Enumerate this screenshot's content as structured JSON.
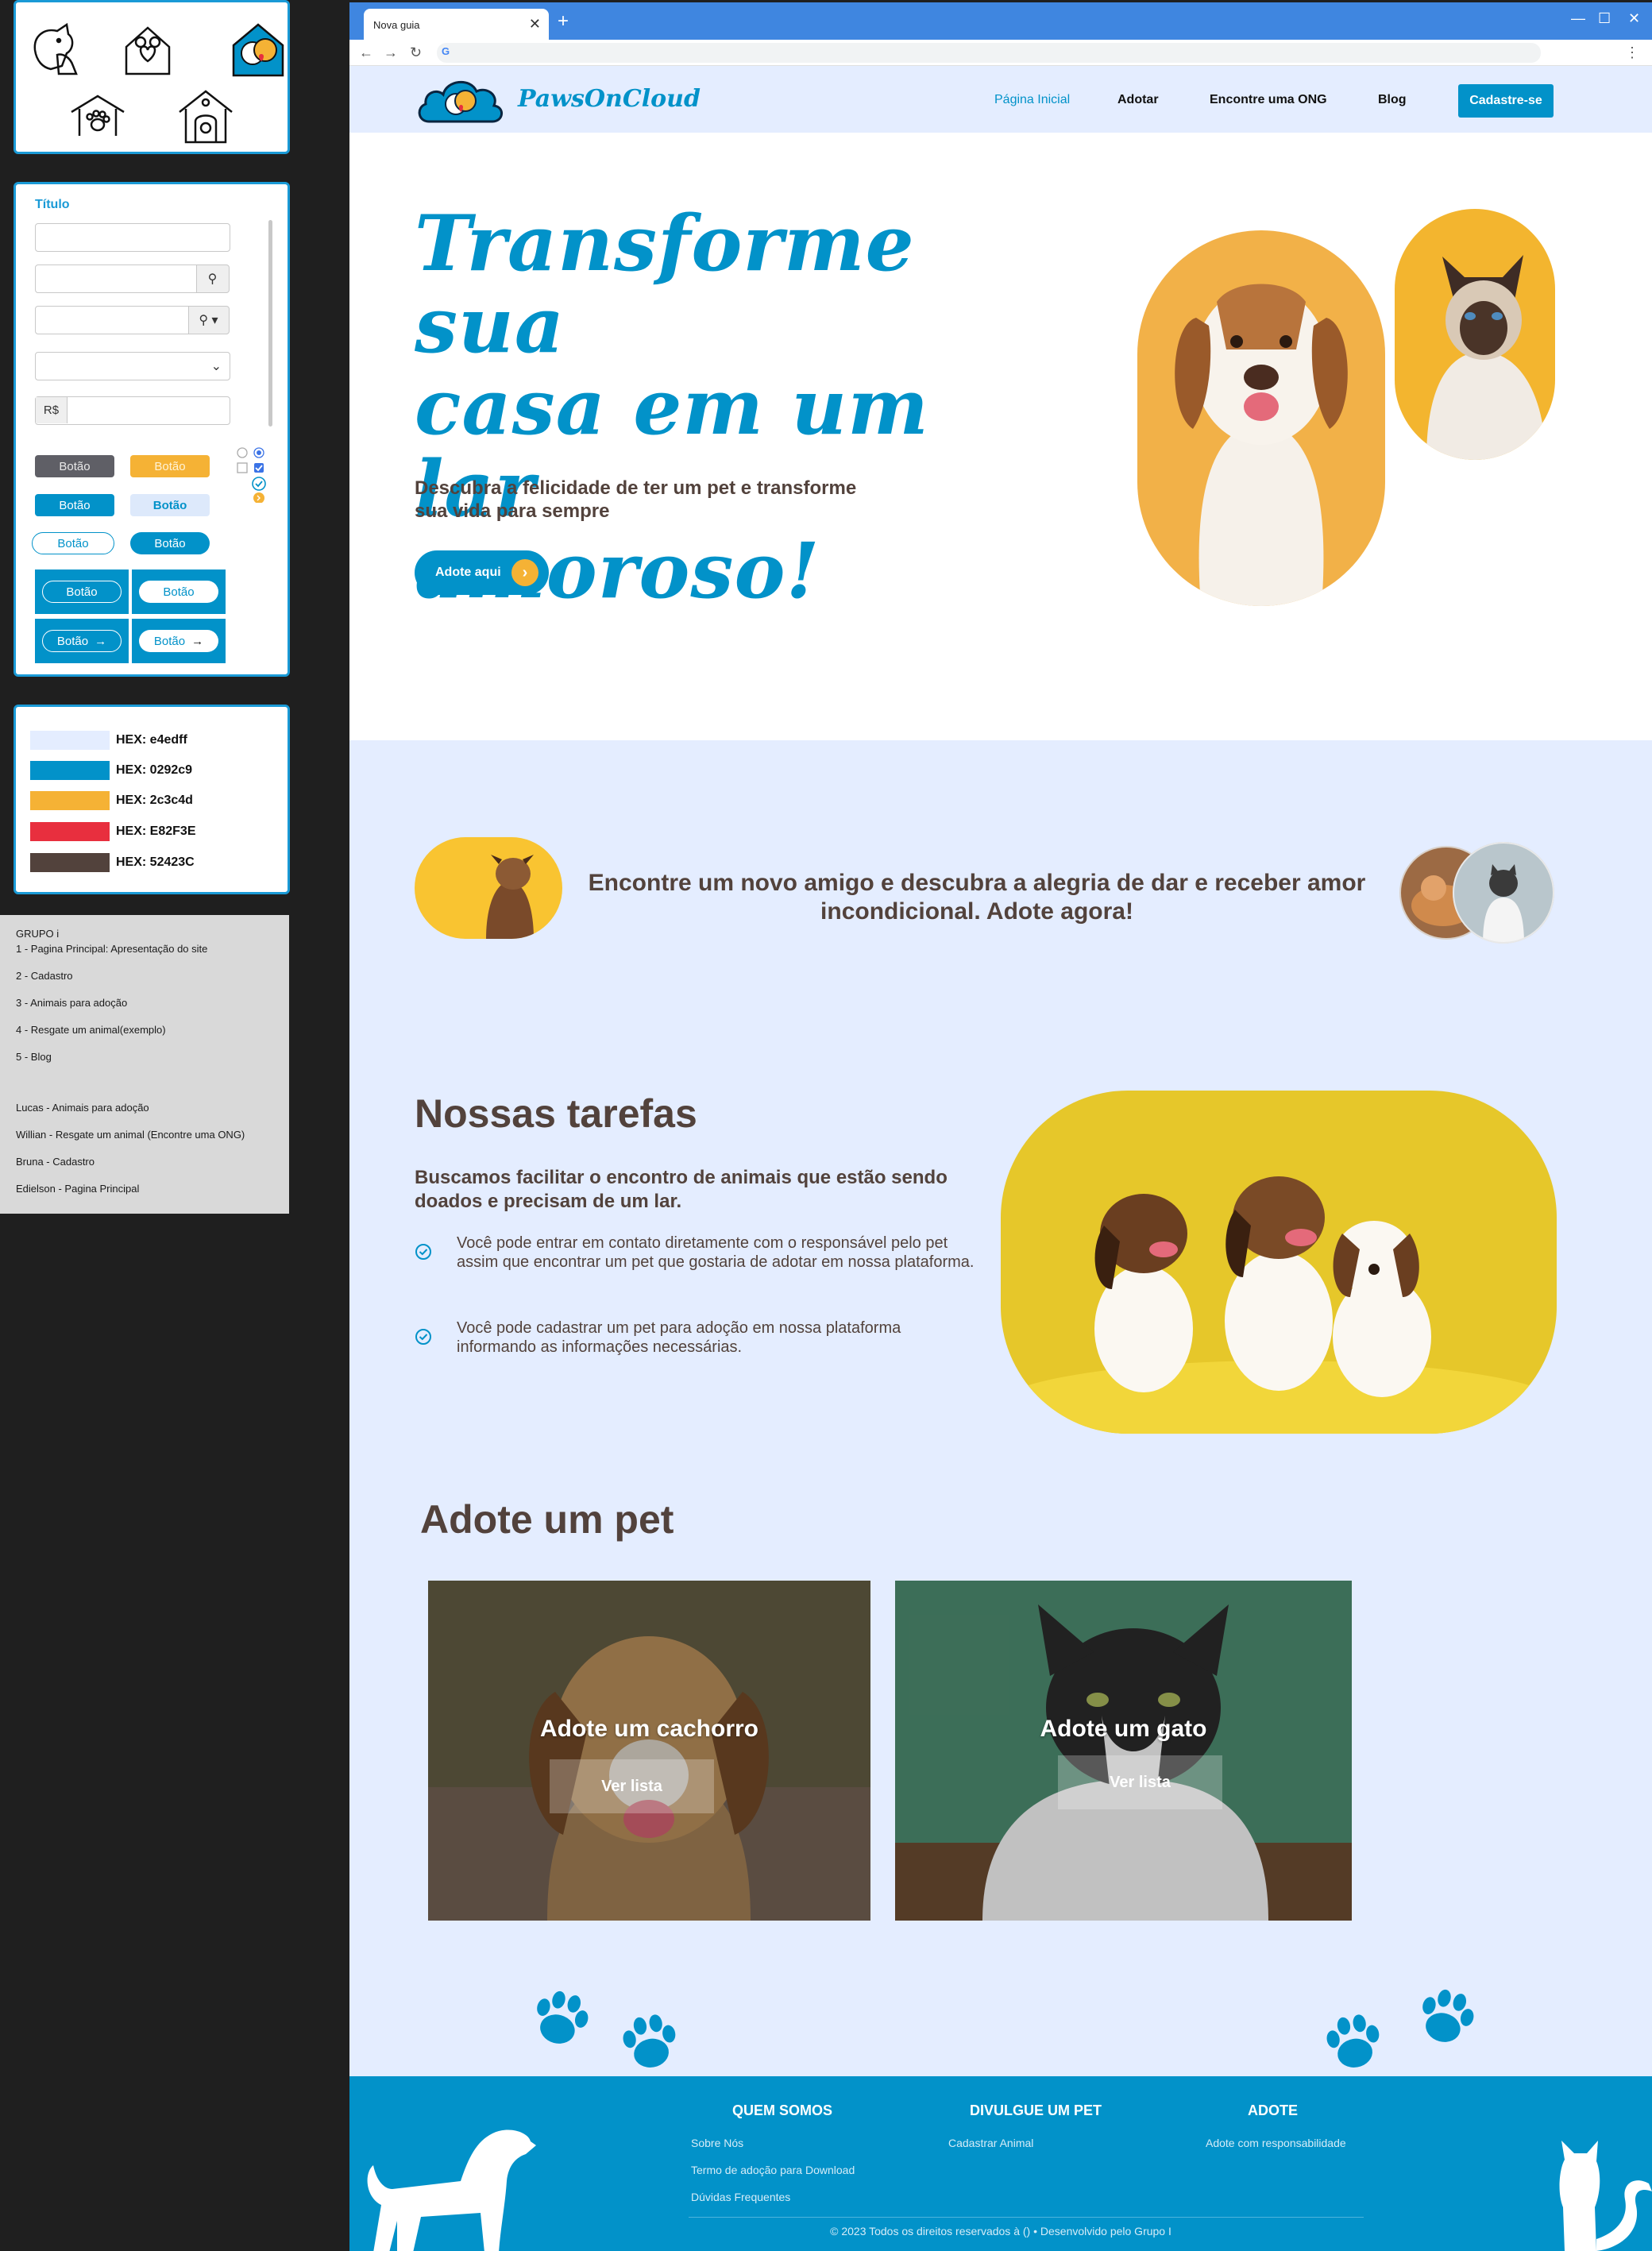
{
  "style_guide": {
    "icons": [
      "dog-cat-icon",
      "house-heart-icon",
      "house-pets-icon",
      "house-paw-icon",
      "doghouse-icon"
    ],
    "forms": {
      "title": "Título",
      "currency_prefix": "R$",
      "button_label": "Botão"
    },
    "colors": [
      {
        "hex": "#e4edff",
        "label": "HEX: e4edff"
      },
      {
        "hex": "#0292c9",
        "label": "HEX: 0292c9"
      },
      {
        "hex": "#f5b235",
        "label": "HEX: 2c3c4d"
      },
      {
        "hex": "#e82f3e",
        "label": "HEX: E82F3E"
      },
      {
        "hex": "#52423c",
        "label": "HEX: 52423C"
      }
    ],
    "notes": {
      "group": "GRUPO i",
      "pages": [
        "1 - Pagina Principal: Apresentação do site",
        "2 - Cadastro",
        "3 - Animais para adoção",
        "4 - Resgate um animal(exemplo)",
        "5 - Blog"
      ],
      "members": [
        "Lucas - Animais para adoção",
        "Willian - Resgate um animal (Encontre uma ONG)",
        "Bruna - Cadastro",
        "Edielson - Pagina Principal"
      ]
    }
  },
  "browser": {
    "tab_title": "Nova guia",
    "tab_close": "✕",
    "new_tab": "+",
    "window_controls": [
      "—",
      "☐",
      "✕"
    ],
    "nav_icons": [
      "←",
      "→",
      "↻"
    ],
    "menu_icon": "⋮",
    "search_engine_icon": "G"
  },
  "site": {
    "logo_text": "PawsOnCloud",
    "nav": [
      {
        "label": "Página Inicial",
        "active": true
      },
      {
        "label": "Adotar",
        "active": false
      },
      {
        "label": "Encontre uma ONG",
        "active": false
      },
      {
        "label": "Blog",
        "active": false
      }
    ],
    "signup_label": "Cadastre-se",
    "hero": {
      "title_lines": [
        "Transforme sua",
        "casa em um lar",
        "amoroso!"
      ],
      "subtitle": "Descubra a felicidade de ter um pet e transforme sua vida para sempre",
      "cta": "Adote aqui",
      "cta_arrow": "›"
    },
    "banner": "Encontre um novo amigo e descubra a alegria de dar e receber amor incondicional. Adote agora!",
    "tasks": {
      "title": "Nossas tarefas",
      "lead": "Buscamos facilitar o encontro de animais que estão sendo doados e precisam de um lar.",
      "items": [
        "Você pode entrar em contato diretamente com o responsável pelo pet assim que encontrar um pet que gostaria de adotar em nossa plataforma.",
        "Você pode cadastrar um pet para adoção em nossa plataforma informando as informações necessárias."
      ]
    },
    "adopt": {
      "title": "Adote um pet",
      "cards": [
        {
          "title": "Adote um cachorro",
          "button": "Ver lista"
        },
        {
          "title": "Adote um gato",
          "button": "Ver lista"
        }
      ]
    },
    "footer": {
      "columns": [
        {
          "heading": "QUEM SOMOS",
          "links": [
            "Sobre Nós",
            "Termo de adoção para Download",
            "Dúvidas Frequentes"
          ]
        },
        {
          "heading": "DIVULGUE UM PET",
          "links": [
            "Cadastrar Animal"
          ]
        },
        {
          "heading": "ADOTE",
          "links": [
            "Adote com responsabilidade"
          ]
        }
      ],
      "copyright": "© 2023 Todos os direitos reservados à () • Desenvolvido pelo Grupo I"
    }
  }
}
